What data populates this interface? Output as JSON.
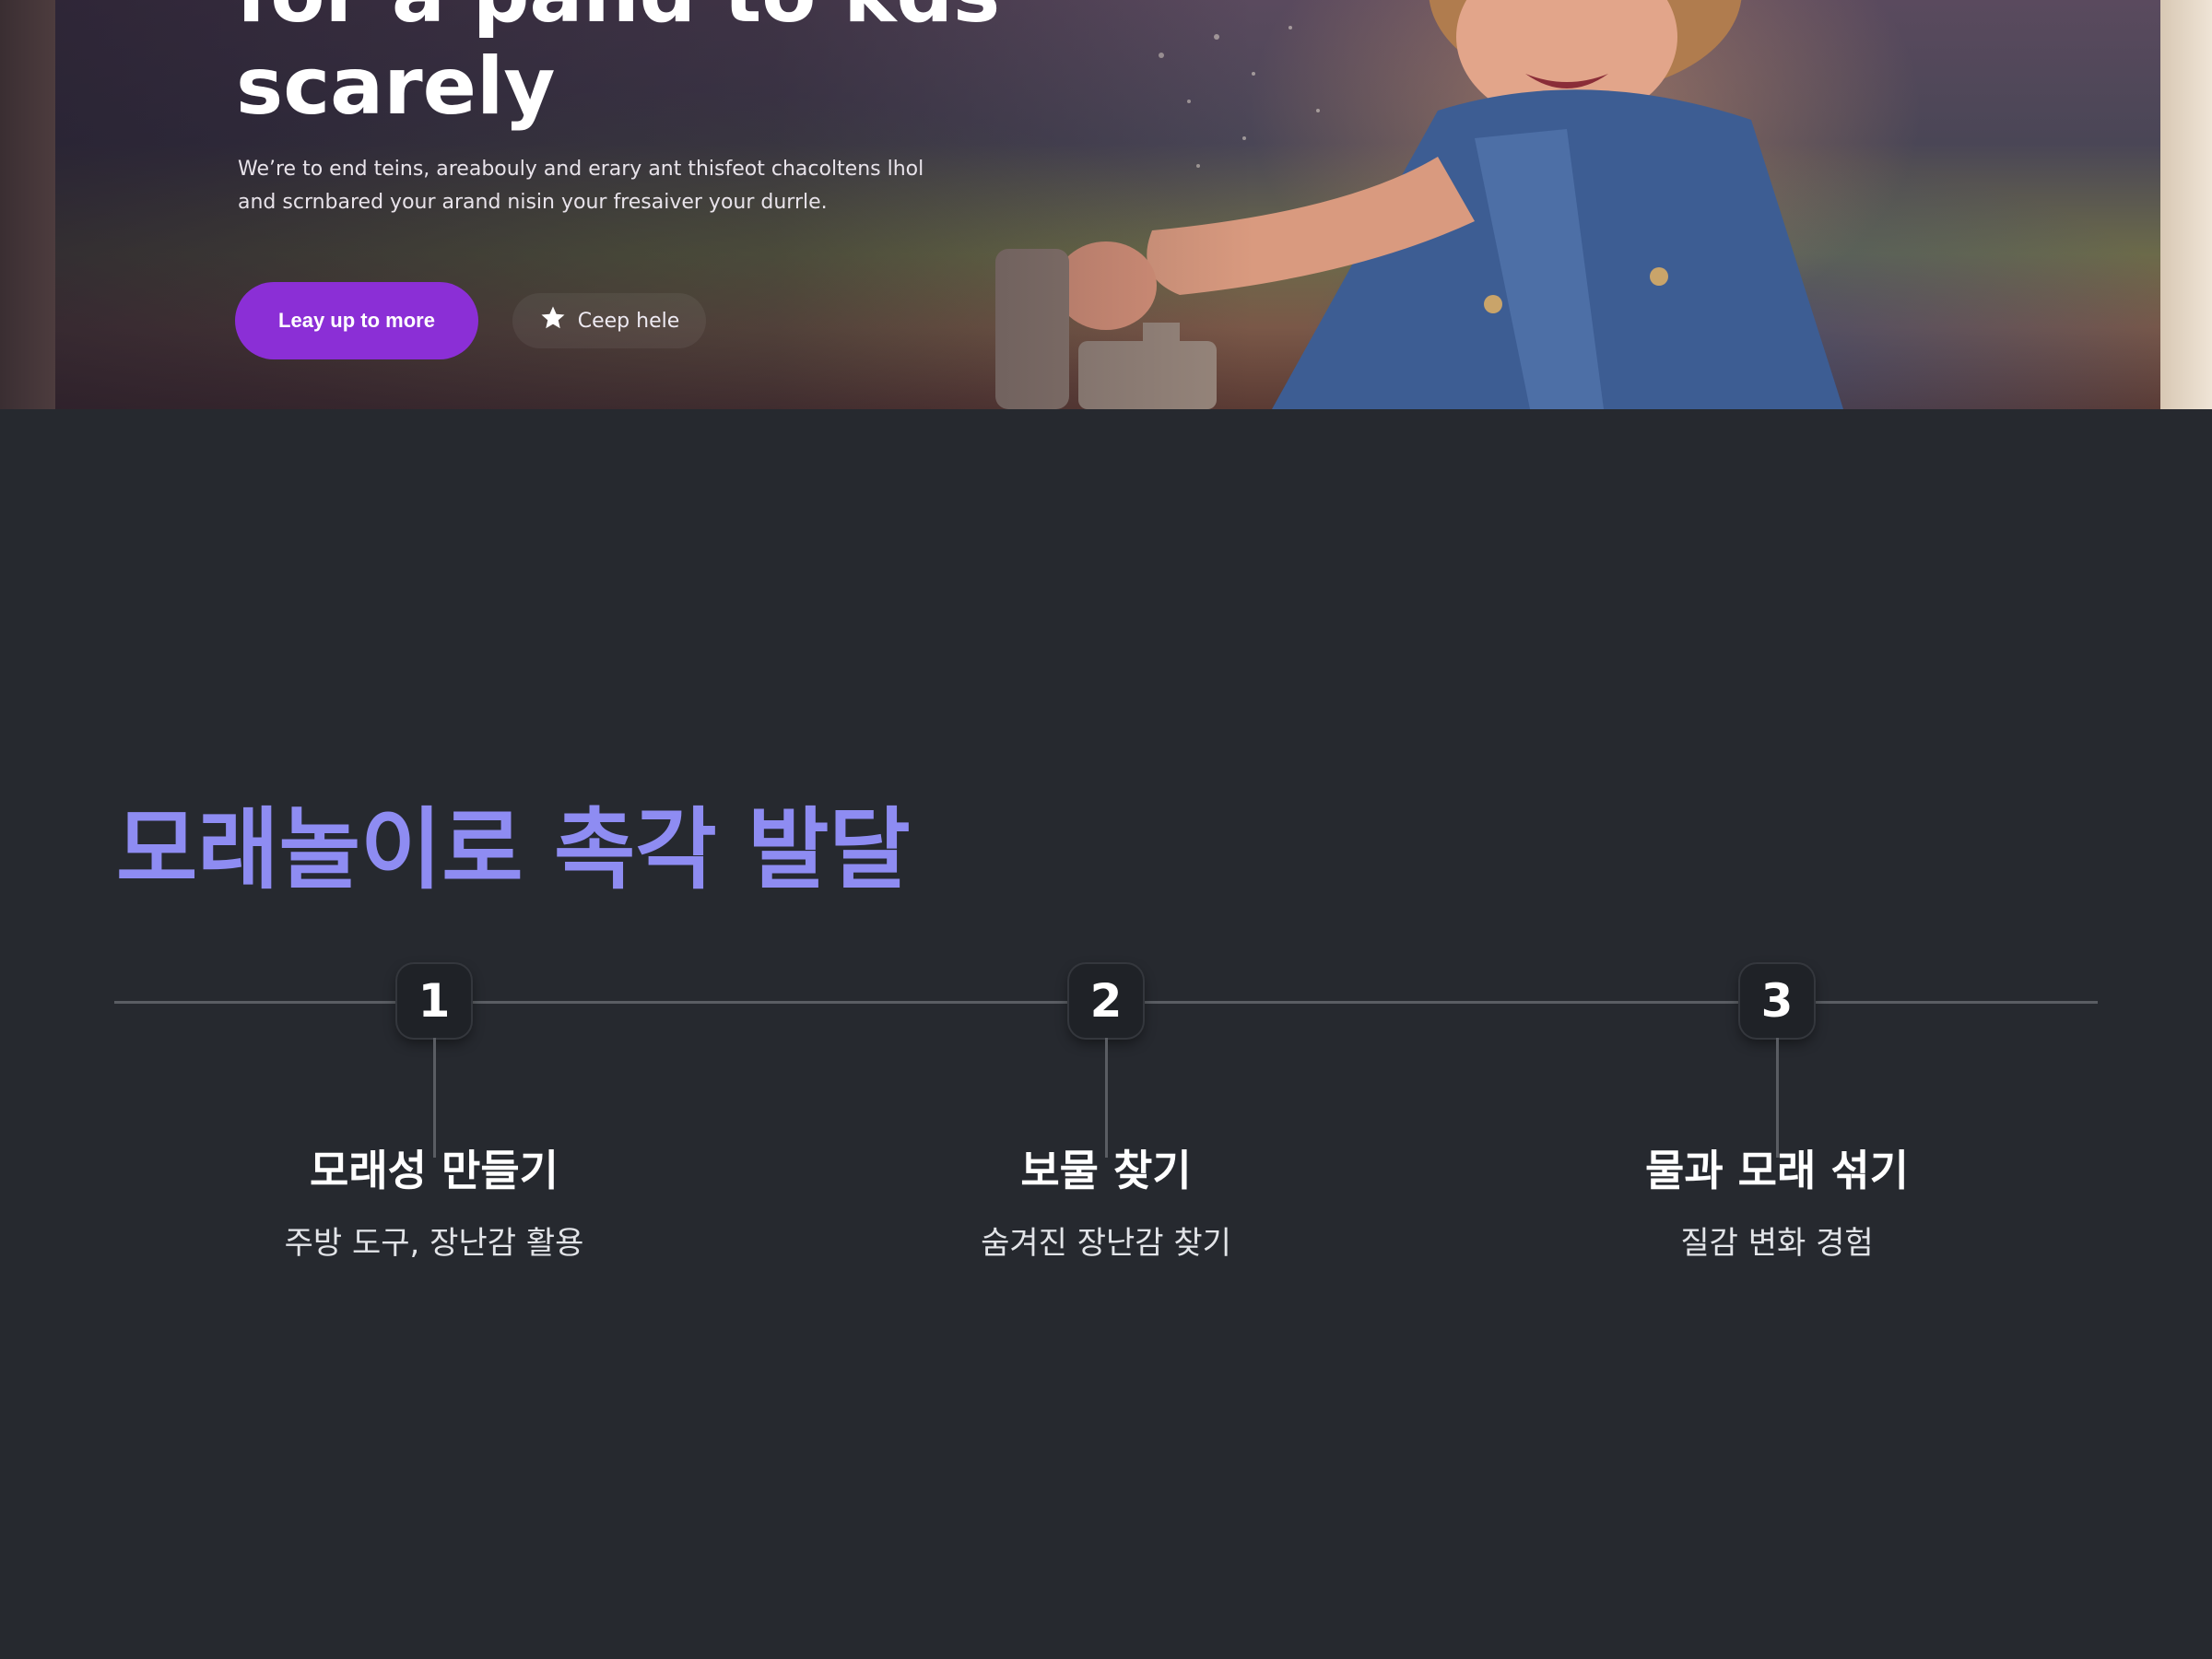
{
  "hero": {
    "heading_line1": "for a pand to kds",
    "heading_line2": "scarely",
    "text_line1": "We’re to end teins, areabouly and erary ant thisfeot chacoltens lhol",
    "text_line2": "and scrnbared your arand nisin your fresaiver your durrle.",
    "primary_button": "Leay up to more",
    "secondary_button": "Ceep hele"
  },
  "section": {
    "title": "모래놀이로 촉각 발달"
  },
  "steps": [
    {
      "number": "1",
      "title": "모래성 만들기",
      "description": "주방 도구, 장난감 활용"
    },
    {
      "number": "2",
      "title": "보물 찾기",
      "description": "숨겨진 장난감 찾기"
    },
    {
      "number": "3",
      "title": "물과 모래 섞기",
      "description": "질감 변화 경험"
    }
  ],
  "colors": {
    "background": "#26292f",
    "accent_title": "#8e8cf2",
    "primary_button": "#8b2fd6",
    "timeline": "#5a5d63"
  }
}
